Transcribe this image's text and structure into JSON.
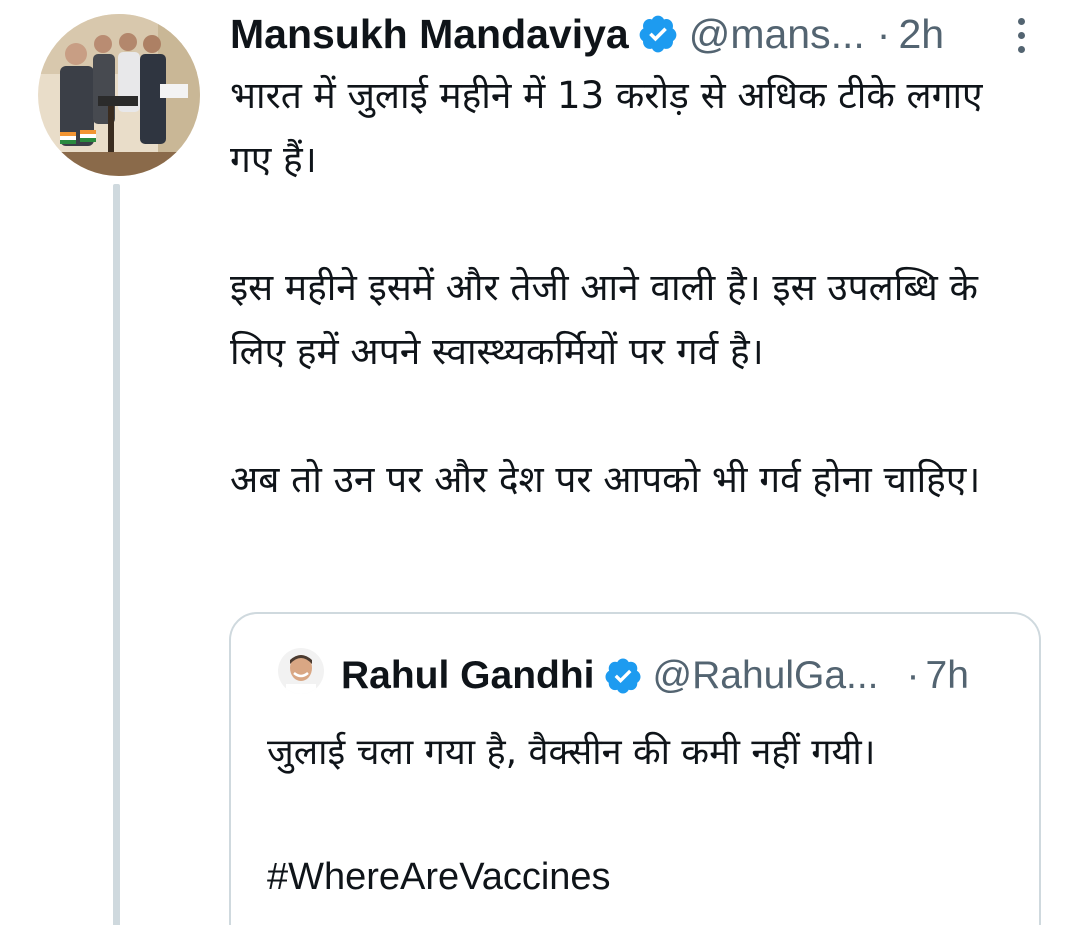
{
  "tweet": {
    "author_name": "Mansukh Mandaviya",
    "handle": "@mans...",
    "dot": "·",
    "time": "2h",
    "paragraphs": [
      "भारत में जुलाई महीने में 13 करोड़ से अधिक टीके लगाए गए हैं।",
      "इस महीने इसमें और तेजी आने वाली है। इस उपलब्धि के लिए हमें अपने स्वास्थ्यकर्मियों पर गर्व है।",
      "अब तो उन पर और देश पर आपको भी गर्व होना चाहिए।"
    ]
  },
  "quoted_tweet": {
    "author_name": "Rahul Gandhi",
    "handle": "@RahulGa...",
    "dot": "·",
    "time": "7h",
    "text": "जुलाई चला गया है, वैक्सीन की कमी नहीं गयी।",
    "hashtag": "#WhereAreVaccines"
  },
  "icons": {
    "verified": "verified-badge-icon",
    "more": "more-vertical-icon"
  },
  "colors": {
    "verified_blue": "#1d9bf0",
    "secondary_text": "#536471",
    "primary_text": "#0f1419",
    "border": "#cfd9de"
  }
}
